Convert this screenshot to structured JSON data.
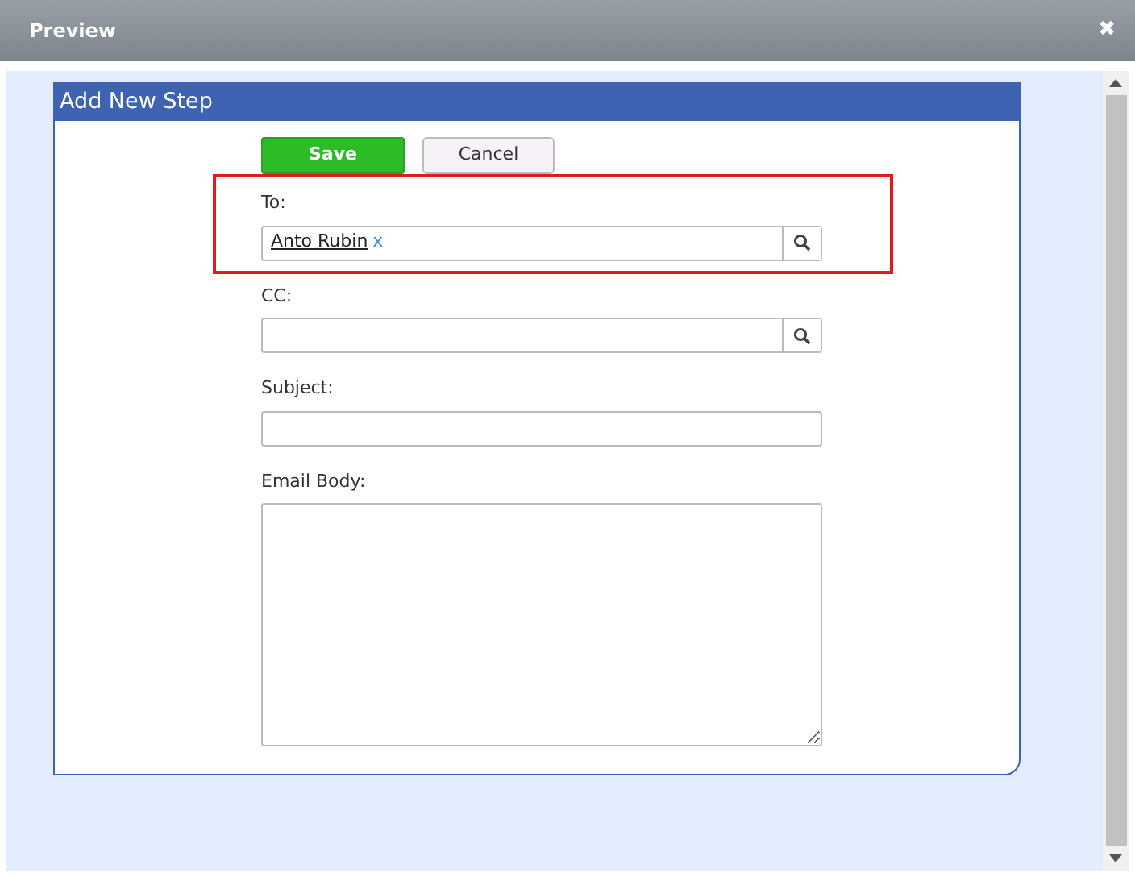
{
  "window": {
    "title": "Preview",
    "close": "✖"
  },
  "form": {
    "title": "Add New Step",
    "buttons": [
      {
        "label": "Save",
        "kind": "primary"
      },
      {
        "label": "Cancel",
        "kind": "secondary"
      }
    ],
    "fields": [
      {
        "label": "To:",
        "kind": "lookup",
        "highlighted": true,
        "recipients": [
          {
            "name": "Anto Rubin",
            "remove": "x"
          }
        ]
      },
      {
        "label": "CC:",
        "kind": "lookup",
        "highlighted": false
      },
      {
        "label": "Subject:",
        "kind": "text",
        "highlighted": false
      },
      {
        "label": "Email Body:",
        "kind": "textarea",
        "highlighted": false
      }
    ]
  }
}
